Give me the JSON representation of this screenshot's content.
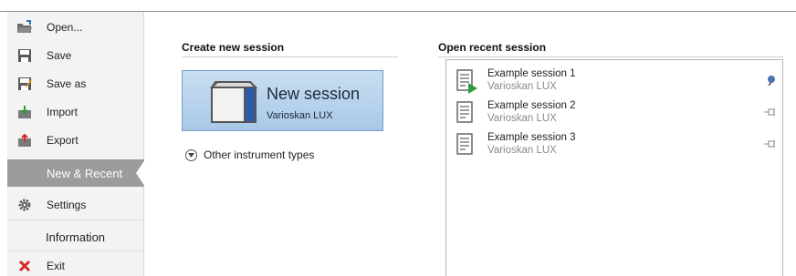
{
  "sidebar": {
    "items": [
      {
        "label": "Open...",
        "icon": "folder-open-icon"
      },
      {
        "label": "Save",
        "icon": "save-icon"
      },
      {
        "label": "Save as",
        "icon": "save-as-icon"
      },
      {
        "label": "Import",
        "icon": "import-icon"
      },
      {
        "label": "Export",
        "icon": "export-icon"
      },
      {
        "label": "New & Recent",
        "selected": true
      },
      {
        "label": "Settings",
        "icon": "gear-icon"
      },
      {
        "label": "Information"
      },
      {
        "label": "Exit",
        "icon": "close-icon"
      }
    ]
  },
  "create": {
    "title": "Create new session",
    "tile_title": "New session",
    "tile_subtitle": "Varioskan LUX",
    "other_label": "Other instrument types"
  },
  "recent": {
    "title": "Open recent session",
    "items": [
      {
        "name": "Example session 1",
        "instrument": "Varioskan LUX",
        "pinned": true
      },
      {
        "name": "Example session 2",
        "instrument": "Varioskan LUX",
        "pinned": false
      },
      {
        "name": "Example session 3",
        "instrument": "Varioskan LUX",
        "pinned": false
      }
    ]
  },
  "colors": {
    "sidebar_bg": "#f3f3f3",
    "selected_bg": "#9c9c9c",
    "tile_bg": "#b8d3ee",
    "tile_border": "#6f9ec9",
    "exit_red": "#d9272e",
    "run_green": "#2f9a3a"
  }
}
